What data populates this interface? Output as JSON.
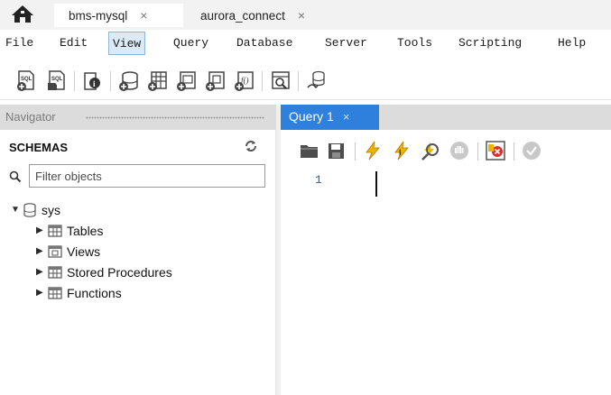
{
  "connection_tabs": [
    {
      "label": "bms-mysql",
      "close": "×",
      "active": true
    },
    {
      "label": "aurora_connect",
      "close": "×",
      "active": false
    }
  ],
  "menu": [
    "File",
    "Edit",
    "View",
    "Query",
    "Database",
    "Server",
    "Tools",
    "Scripting",
    "Help"
  ],
  "menu_active": "View",
  "toolbar_icons": [
    "new-sql-tab-icon",
    "open-sql-script-icon",
    "inspector-icon",
    "create-schema-icon",
    "create-table-icon",
    "create-view-icon",
    "create-procedure-icon",
    "create-function-icon",
    "search-table-data-icon",
    "reconnect-icon"
  ],
  "navigator": {
    "title": "Navigator",
    "schemas_label": "SCHEMAS",
    "filter_placeholder": "Filter objects",
    "tree": {
      "schema": "sys",
      "children": [
        "Tables",
        "Views",
        "Stored Procedures",
        "Functions"
      ]
    }
  },
  "query": {
    "tab_label": "Query 1",
    "tab_close": "×",
    "line_number": "1",
    "toolbar_icons": [
      "open-file-icon",
      "save-icon",
      "execute-icon",
      "execute-current-icon",
      "explain-icon",
      "stop-icon",
      "toggle-error-icon",
      "commit-icon"
    ]
  },
  "colors": {
    "accent": "#2f7fdc",
    "lightning": "#f0b400",
    "db_icon": "#6a6a6a"
  }
}
